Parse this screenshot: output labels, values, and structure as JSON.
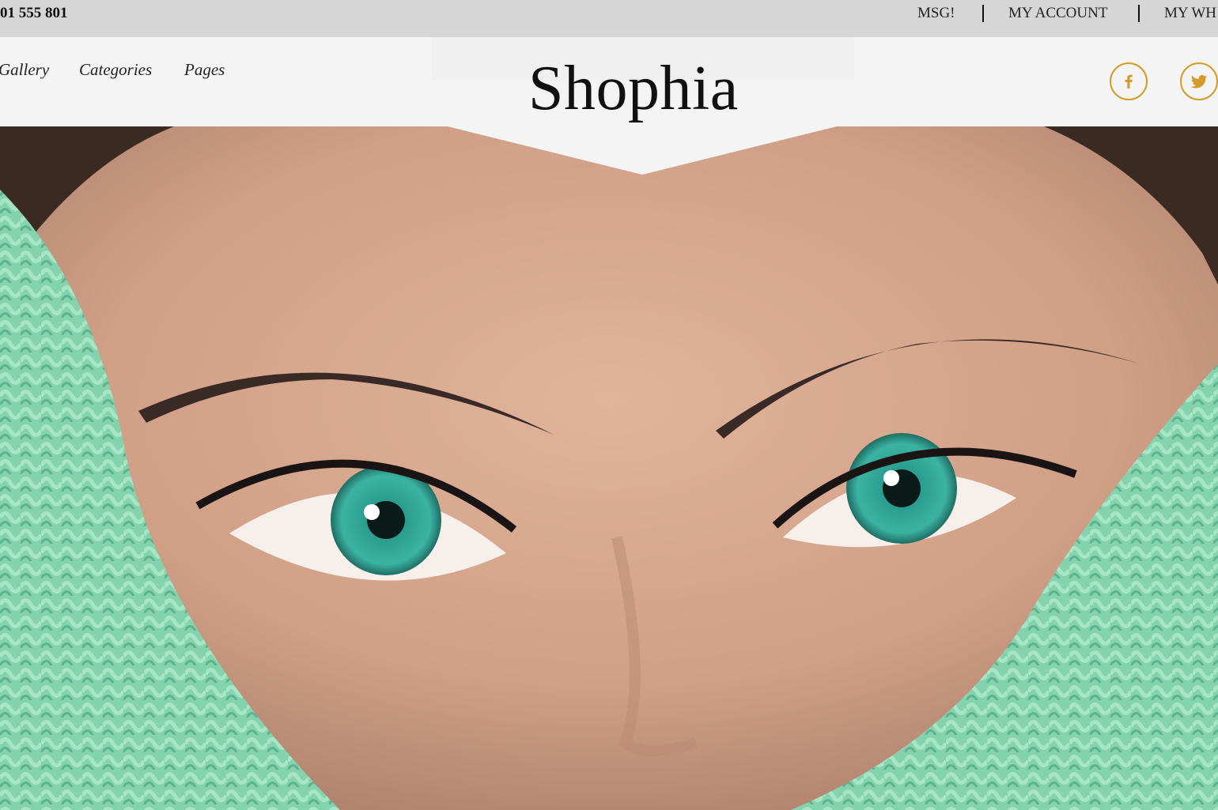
{
  "topbar": {
    "phone": "01 555 801",
    "links": [
      "MSG!",
      "MY ACCOUNT",
      "MY WH"
    ]
  },
  "nav": {
    "items": [
      "Gallery",
      "Categories",
      "Pages"
    ]
  },
  "logo": {
    "text": "Shophia"
  },
  "social": {
    "icons": [
      "facebook-icon",
      "twitter-icon"
    ],
    "accent_color": "#d39b2a"
  },
  "hero": {
    "image": "close-up of a woman's green eyes above a mint knit scarf",
    "eye_color": "#2fa79a",
    "scarf_color": "#8fd9b6"
  }
}
